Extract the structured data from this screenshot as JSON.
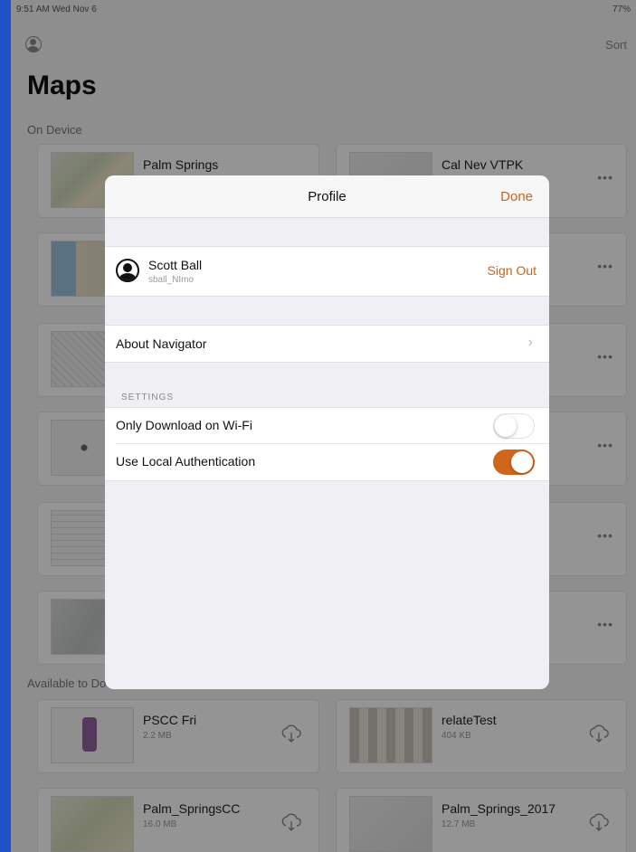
{
  "status_bar": {
    "time": "9:51 AM  Wed Nov 6",
    "battery": "77%"
  },
  "header": {
    "sort_label": "Sort",
    "title": "Maps"
  },
  "sections": {
    "on_device": "On Device",
    "available": "Available to Download"
  },
  "maps_on_device": [
    {
      "name": "Palm Springs",
      "size": ""
    },
    {
      "name": "Cal Nev VTPK",
      "size": ""
    },
    {
      "name": "",
      "size": ""
    },
    {
      "name": "",
      "size": ""
    },
    {
      "name": "",
      "size": ""
    },
    {
      "name": "",
      "size": ""
    },
    {
      "name": "",
      "size": ""
    },
    {
      "name": "",
      "size": ""
    },
    {
      "name": "",
      "size": ""
    },
    {
      "name": "",
      "size": ""
    },
    {
      "name": "",
      "size": ""
    },
    {
      "name": "",
      "size": ""
    }
  ],
  "maps_available": [
    {
      "name": "PSCC Fri",
      "size": "2.2 MB"
    },
    {
      "name": "relateTest",
      "size": "404 KB"
    },
    {
      "name": "Palm_SpringsCC",
      "size": "16.0 MB"
    },
    {
      "name": "Palm_Springs_2017",
      "size": "12.7 MB"
    }
  ],
  "profile_modal": {
    "title": "Profile",
    "done_label": "Done",
    "user": {
      "name": "Scott Ball",
      "handle": "sball_NImo"
    },
    "sign_out_label": "Sign Out",
    "about_label": "About Navigator",
    "settings_header": "SETTINGS",
    "settings": {
      "wifi_only": {
        "label": "Only Download on Wi-Fi",
        "enabled": false
      },
      "local_auth": {
        "label": "Use Local Authentication",
        "enabled": true
      }
    }
  },
  "colors": {
    "accent": "#d0661c",
    "background_frame": "#1f52c8"
  }
}
